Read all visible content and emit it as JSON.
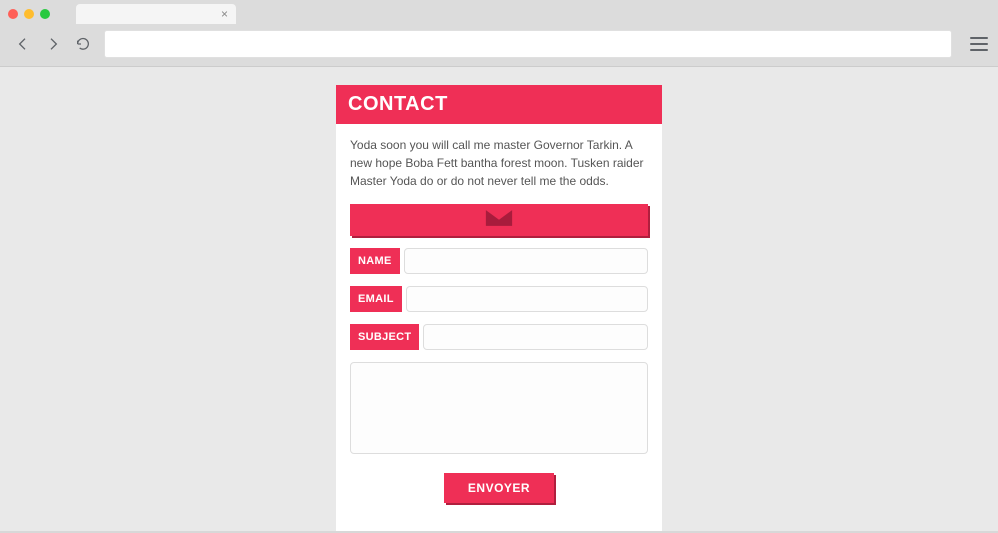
{
  "header": {
    "title": "CONTACT"
  },
  "intro_text": "Yoda soon you will call me master Governor Tarkin. A new hope Boba Fett bantha forest moon. Tusken raider Master Yoda do or do not never tell me the odds.",
  "fields": {
    "name": {
      "label": "NAME",
      "value": ""
    },
    "email": {
      "label": "EMAIL",
      "value": ""
    },
    "subject": {
      "label": "SUBJECT",
      "value": ""
    },
    "message": {
      "value": ""
    }
  },
  "submit_label": "ENVOYER"
}
